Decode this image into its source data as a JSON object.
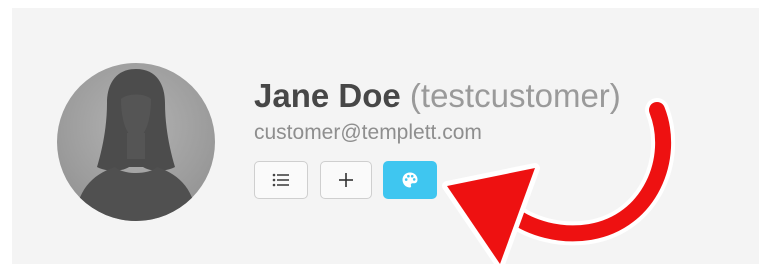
{
  "profile": {
    "name": "Jane Doe",
    "username": "(testcustomer)",
    "email": "customer@templett.com"
  },
  "actions": [
    {
      "icon": "list-icon"
    },
    {
      "icon": "plus-icon"
    },
    {
      "icon": "palette-icon",
      "active": true
    }
  ],
  "colors": {
    "card_background": "#f4f4f4",
    "name_text": "#474747",
    "secondary_text": "#9a9a9a",
    "accent_button": "#3fc6f0",
    "annotation_arrow": "#ee1111"
  },
  "annotation": {
    "icon": "curved-arrow-icon"
  }
}
